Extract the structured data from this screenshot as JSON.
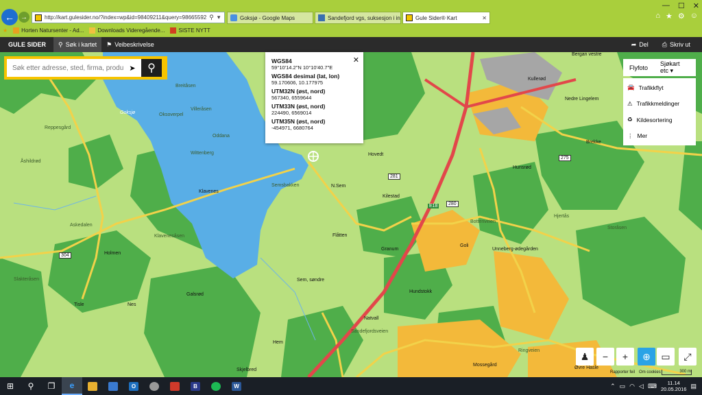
{
  "browser": {
    "url": "http://kart.gulesider.no/?index=wp&id=98409211&query=98665592",
    "tabs": [
      {
        "label": "Goksjø - Google Maps"
      },
      {
        "label": "Sandefjord vgs, suksesjon i inn..."
      },
      {
        "label": "Gule Sider® Kart"
      }
    ],
    "favorites": [
      "Horten Natursenter - Ad...",
      "Downloads  Videregående...",
      "SISTE NYTT"
    ]
  },
  "header": {
    "logo": "GULE SIDER",
    "search_tab": "Søk i kartet",
    "route_tab": "Veibeskrivelse",
    "share": "Del",
    "print": "Skriv ut"
  },
  "search": {
    "placeholder": "Søk etter adresse, sted, firma, produkt"
  },
  "popup": {
    "wgs84_title": "WGS84",
    "wgs84_value": "59°10'14.2\"N 10°10'40.7\"E",
    "decimal_title": "WGS84 desimal (lat, lon)",
    "decimal_value": "59.170606, 10.177975",
    "utm32_title": "UTM32N (øst, nord)",
    "utm32_value": "567340, 6559644",
    "utm33_title": "UTM33N (øst, nord)",
    "utm33_value": "224490, 6569014",
    "utm35_title": "UTM35N (øst, nord)",
    "utm35_value": "-454971, 6680764"
  },
  "layers": {
    "flyfoto": "Flyfoto",
    "sjokart": "Sjøkart etc",
    "items": [
      "Trafikkflyt",
      "Trafikkmeldinger",
      "Kildesortering",
      "Mer"
    ]
  },
  "map": {
    "labels": {
      "goksjo": "Goksjø",
      "reppesgard": "Reppesgård",
      "ashildrod": "Åshildrød",
      "askedalen": "Askedalen",
      "holmen": "Holmen",
      "klavenes": "Klavenes",
      "klavenesasen": "Klavenesåsen",
      "slakteraasen": "Slakteråsen",
      "tisle": "Tisle",
      "nes": "Nes",
      "galsrod": "Galsrød",
      "hem": "Hem",
      "skjelbred": "Skjelbred",
      "nsem": "N.Sem",
      "kilestad": "Kilestad",
      "flatten": "Flåtten",
      "granum": "Granum",
      "goli": "Goli",
      "sem_sondre": "Sem, søndre",
      "natvall": "Natvall",
      "hundstokk": "Hundstokk",
      "hovedt": "Hovedt",
      "hunsrod": "Hunsrød",
      "kullerod": "Kullerød",
      "nedre_lingelem": "Nedre Lingelem",
      "brekke": "Brekke",
      "bergan_vestre": "Bergan vestre",
      "unneberg": "Unneberg-ødegården",
      "mossegard": "Mossegård",
      "ovre_hasle": "Øvre Hasle",
      "breitasen": "Breitåsen",
      "villeraasen": "Villeråsen",
      "oksoverpel": "Oksoverpel",
      "oddana": "Oddana",
      "wittenberg": "Wittenberg",
      "semsbakken": "Semsbakken",
      "sandefjordsveien": "Sandefjordsveien",
      "bottenveien": "Bottenveien",
      "ringveien": "Ringveien",
      "storasen": "Storåsen",
      "hjertas": "Hjertås",
      "roads": {
        "r281": "281",
        "r280": "280",
        "r275": "275",
        "r304": "304",
        "e18": "E18"
      }
    }
  },
  "attribution": {
    "report": "Rapporter feil",
    "cookies": "Om cookies",
    "scale": "300 m"
  },
  "taskbar": {
    "time": "11.14",
    "date": "20.05.2016"
  },
  "colors": {
    "accent": "#f7c400",
    "chrome": "#a9cf3c",
    "water": "#59aee6",
    "forest": "#4fae4a",
    "road_main": "#e2474a"
  }
}
